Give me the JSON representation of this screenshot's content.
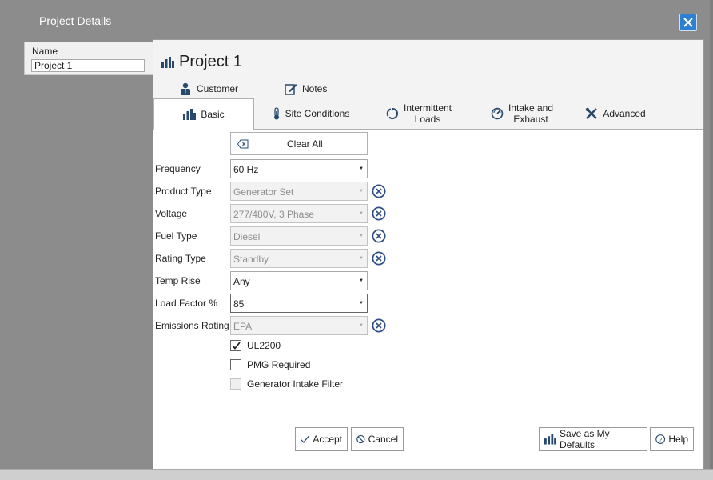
{
  "window": {
    "title": "Project Details"
  },
  "sidebar": {
    "name_label": "Name",
    "name_value": "Project 1"
  },
  "dialog": {
    "title": "Project 1"
  },
  "top_tabs": [
    {
      "label": "Customer"
    },
    {
      "label": "Notes"
    }
  ],
  "tabs": [
    {
      "label": "Basic"
    },
    {
      "label": "Site Conditions"
    },
    {
      "label_line1": "Intermittent",
      "label_line2": "Loads"
    },
    {
      "label_line1": "Intake and",
      "label_line2": "Exhaust"
    },
    {
      "label": "Advanced"
    }
  ],
  "form": {
    "clear_all": "Clear All",
    "fields": [
      {
        "label": "Frequency",
        "value": "60 Hz"
      },
      {
        "label": "Product Type",
        "value": "Generator Set"
      },
      {
        "label": "Voltage",
        "value": "277/480V, 3 Phase"
      },
      {
        "label": "Fuel Type",
        "value": "Diesel"
      },
      {
        "label": "Rating Type",
        "value": "Standby"
      },
      {
        "label": "Temp Rise",
        "value": "Any"
      },
      {
        "label": "Load Factor %",
        "value": "85"
      },
      {
        "label": "Emissions Rating",
        "value": "EPA"
      }
    ],
    "checkboxes": [
      {
        "label": "UL2200",
        "checked": true
      },
      {
        "label": "PMG Required",
        "checked": false
      },
      {
        "label": "Generator Intake Filter",
        "checked": false
      }
    ]
  },
  "buttons": {
    "accept": "Accept",
    "cancel": "Cancel",
    "save_defaults": "Save as My Defaults",
    "help": "Help"
  },
  "colors": {
    "accent_blue": "#2c7fd3",
    "overlay_gray": "#8c8c8c"
  }
}
